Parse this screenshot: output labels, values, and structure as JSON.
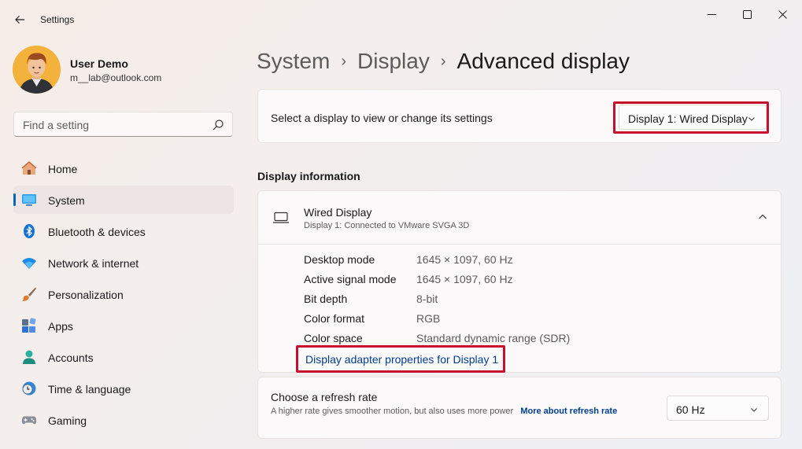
{
  "app": {
    "title": "Settings"
  },
  "user": {
    "name": "User Demo",
    "email": "m__lab@outlook.com"
  },
  "search": {
    "placeholder": "Find a setting"
  },
  "nav": {
    "items": [
      {
        "label": "Home",
        "icon": "home-icon",
        "active": false
      },
      {
        "label": "System",
        "icon": "system-icon",
        "active": true
      },
      {
        "label": "Bluetooth & devices",
        "icon": "bluetooth-icon",
        "active": false
      },
      {
        "label": "Network & internet",
        "icon": "wifi-icon",
        "active": false
      },
      {
        "label": "Personalization",
        "icon": "brush-icon",
        "active": false
      },
      {
        "label": "Apps",
        "icon": "apps-icon",
        "active": false
      },
      {
        "label": "Accounts",
        "icon": "accounts-icon",
        "active": false
      },
      {
        "label": "Time & language",
        "icon": "clock-globe-icon",
        "active": false
      },
      {
        "label": "Gaming",
        "icon": "gamepad-icon",
        "active": false
      }
    ]
  },
  "breadcrumb": {
    "system": "System",
    "display": "Display",
    "current": "Advanced display",
    "separator": "›"
  },
  "display_select": {
    "label": "Select a display to view or change its settings",
    "value": "Display 1: Wired Display"
  },
  "display_info": {
    "section_title": "Display information",
    "title": "Wired Display",
    "subtitle": "Display 1: Connected to VMware SVGA 3D",
    "rows": [
      {
        "key": "Desktop mode",
        "value": "1645 × 1097, 60 Hz"
      },
      {
        "key": "Active signal mode",
        "value": "1645 × 1097, 60 Hz"
      },
      {
        "key": "Bit depth",
        "value": "8-bit"
      },
      {
        "key": "Color format",
        "value": "RGB"
      },
      {
        "key": "Color space",
        "value": "Standard dynamic range (SDR)"
      }
    ],
    "adapter_link": "Display adapter properties for Display 1"
  },
  "refresh": {
    "title": "Choose a refresh rate",
    "description": "A higher rate gives smoother motion, but also uses more power",
    "link": "More about refresh rate",
    "value": "60 Hz"
  },
  "colors": {
    "accent": "#0067c0",
    "link": "#003e92",
    "highlight": "#c8102e"
  }
}
